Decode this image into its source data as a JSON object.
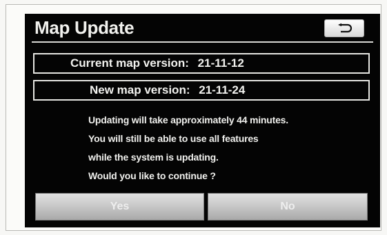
{
  "dialog": {
    "title": "Map Update",
    "back_icon": "return-arrow-icon"
  },
  "versions": {
    "current_label": "Current map version:",
    "current_value": "21-11-12",
    "new_label": "New map version:",
    "new_value": "21-11-24"
  },
  "message": {
    "lines": [
      "Updating will take approximately 44 minutes.",
      "You will still be able to use all features",
      "while the system is updating.",
      "Would you like to continue ?"
    ]
  },
  "buttons": {
    "yes_label": "Yes",
    "no_label": "No"
  },
  "colors": {
    "screen_background": "#040404",
    "text": "#f1f1ee",
    "button": "#c9c9c9"
  }
}
